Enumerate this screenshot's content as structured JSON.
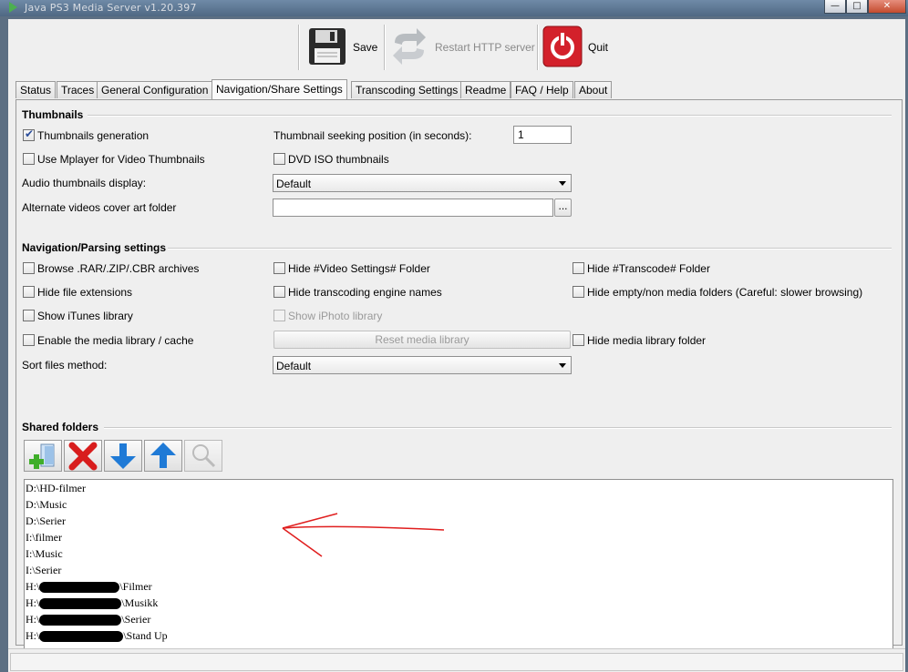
{
  "window": {
    "title": "Java PS3 Media Server v1.20.397"
  },
  "toolbar": {
    "save_label": "Save",
    "restart_label": "Restart HTTP server",
    "quit_label": "Quit"
  },
  "tabs": [
    {
      "label": "Status"
    },
    {
      "label": "Traces"
    },
    {
      "label": "General Configuration"
    },
    {
      "label": "Navigation/Share Settings",
      "active": true
    },
    {
      "label": "Transcoding Settings"
    },
    {
      "label": "Readme"
    },
    {
      "label": "FAQ / Help"
    },
    {
      "label": "About"
    }
  ],
  "thumbnails": {
    "section_title": "Thumbnails",
    "generation": {
      "label": "Thumbnails generation",
      "checked": true
    },
    "seek_label": "Thumbnail seeking position (in seconds):",
    "seek_value": "1",
    "mplayer": {
      "label": "Use Mplayer for Video Thumbnails",
      "checked": false
    },
    "dvd_iso": {
      "label": "DVD ISO thumbnails",
      "checked": false
    },
    "audio_label": "Audio thumbnails display:",
    "audio_value": "Default",
    "cover_label": "Alternate videos cover art folder",
    "cover_value": "",
    "browse_label": "..."
  },
  "navigation": {
    "section_title": "Navigation/Parsing settings",
    "browse_archives": {
      "label": "Browse .RAR/.ZIP/.CBR archives",
      "checked": false
    },
    "hide_video_settings": {
      "label": "Hide #Video Settings# Folder",
      "checked": false
    },
    "hide_transcode": {
      "label": "Hide #Transcode# Folder",
      "checked": false
    },
    "hide_extensions": {
      "label": "Hide file extensions",
      "checked": false
    },
    "hide_engine_names": {
      "label": "Hide transcoding engine names",
      "checked": false
    },
    "hide_empty": {
      "label": "Hide empty/non media folders (Careful: slower browsing)",
      "checked": false
    },
    "show_itunes": {
      "label": "Show iTunes library",
      "checked": false
    },
    "show_iphoto": {
      "label": "Show iPhoto library",
      "checked": false,
      "disabled": true
    },
    "media_library": {
      "label": "Enable the media library / cache",
      "checked": false
    },
    "reset_label": "Reset media library",
    "hide_media_library": {
      "label": "Hide media library folder",
      "checked": false
    },
    "sort_label": "Sort files method:",
    "sort_value": "Default"
  },
  "shared": {
    "section_title": "Shared folders",
    "buttons": [
      {
        "icon": "add-folder-icon"
      },
      {
        "icon": "remove-icon"
      },
      {
        "icon": "arrow-down-icon"
      },
      {
        "icon": "arrow-up-icon"
      },
      {
        "icon": "magnifier-icon"
      }
    ],
    "folders": [
      {
        "prefix": "D:\\HD-filmer",
        "suffix": ""
      },
      {
        "prefix": "D:\\Music",
        "suffix": ""
      },
      {
        "prefix": "D:\\Serier",
        "suffix": ""
      },
      {
        "prefix": "I:\\filmer",
        "suffix": ""
      },
      {
        "prefix": "I:\\Music",
        "suffix": ""
      },
      {
        "prefix": "I:\\Serier",
        "suffix": ""
      },
      {
        "prefix": "H:\\",
        "suffix": "\\Filmer"
      },
      {
        "prefix": "H:\\",
        "suffix": "\\Musikk"
      },
      {
        "prefix": "H:\\",
        "suffix": "\\Serier"
      },
      {
        "prefix": "H:\\",
        "suffix": "\\Stand Up"
      }
    ]
  },
  "colors": {
    "annotation_arrow": "#e01e1e",
    "checkmark": "#2a4c9a",
    "quit_red": "#d3212b"
  }
}
